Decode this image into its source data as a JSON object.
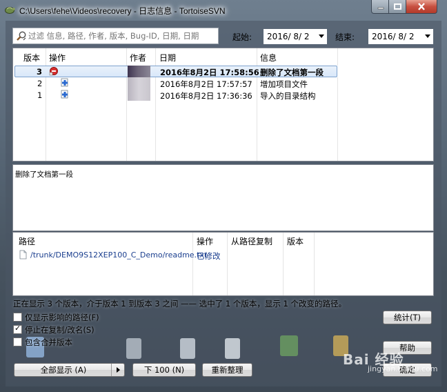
{
  "window": {
    "title": "C:\\Users\\fehe\\Videos\\recovery - 日志信息 - TortoiseSVN"
  },
  "filter": {
    "search_placeholder": "过滤 信息, 路径, 作者, 版本, Bug-ID, 日期, 日期",
    "start_label": "起始:",
    "start_value": "2016/  8/  2",
    "end_label": "结束:",
    "end_value": "2016/  8/  2"
  },
  "revisions": {
    "columns": {
      "rev": "版本",
      "actions": "操作",
      "author": "作者",
      "date": "日期",
      "message": "信息"
    },
    "rows": [
      {
        "rev": "3",
        "action_icon": "delete-icon",
        "author_shade": "dark",
        "date": "2016年8月2日 17:58:56",
        "message": "删除了文档第一段",
        "selected": true
      },
      {
        "rev": "2",
        "action_icon": "modify-icon",
        "author_shade": "light",
        "date": "2016年8月2日 17:57:57",
        "message": "增加项目文件",
        "selected": false
      },
      {
        "rev": "1",
        "action_icon": "add-icon",
        "author_shade": "light",
        "date": "2016年8月2日 17:36:36",
        "message": "导入的目录结构",
        "selected": false
      }
    ]
  },
  "message_panel": {
    "text": "删除了文档第一段"
  },
  "paths": {
    "columns": {
      "path": "路径",
      "action": "操作",
      "copy_from": "从路径复制",
      "rev": "版本"
    },
    "rows": [
      {
        "path": "/trunk/DEMO9S12XEP100_C_Demo/readme.txt",
        "action": "已修改",
        "copy_from": "",
        "rev": ""
      }
    ]
  },
  "status": "正在显示 3 个版本，介于版本 1 到版本 3 之间 —— 选中了 1 个版本，显示 1 个改变的路径。",
  "options": {
    "only_affected": {
      "label": "仅显示影响的路径(F)",
      "checked": false
    },
    "stop_on_copy": {
      "label": "停止在复制/改名(S)",
      "checked": true
    },
    "include_merged": {
      "label": "包含合并版本",
      "checked": false
    }
  },
  "buttons": {
    "show_all": "全部显示 (A)",
    "next_100": "下 100 (N)",
    "refresh": "重新整理",
    "statistics": "统计(T)",
    "help": "帮助",
    "ok": "确定"
  },
  "watermark": {
    "brand": "Bai 经验",
    "site": "jingyan.baidu.com"
  },
  "colors": {
    "selection": "#d8e7f9",
    "link": "#1a3e8e"
  }
}
